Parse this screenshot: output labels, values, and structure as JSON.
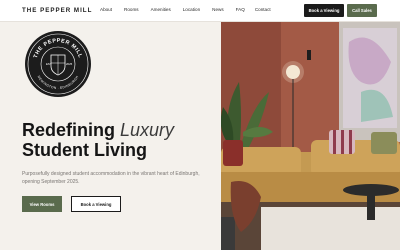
{
  "nav": {
    "brand": "THE PEPPER MILL",
    "items": [
      "About",
      "Rooms",
      "Amenities",
      "Location",
      "News",
      "FAQ",
      "Contact"
    ],
    "book_viewing": "Book a Viewing",
    "call_sales": "Call Sales"
  },
  "logo": {
    "ring_top": "THE PEPPER MILL",
    "ring_bottom": "NEWINGTON · EDINBURGH",
    "est": "EST",
    "year": "2025"
  },
  "hero": {
    "headline_1a": "Redefining",
    "headline_1b": "Luxury",
    "headline_2": "Student Living",
    "subtext": "Purposefully designed student accommodation in the vibrant heart of Edinburgh, opening September 2025.",
    "view_rooms": "View Rooms",
    "book_viewing": "Book a Viewing"
  },
  "colors": {
    "accent_green": "#5a6b4d",
    "dark": "#1b1b1b",
    "wall": "#a85f4a",
    "sofa": "#c9a054"
  }
}
